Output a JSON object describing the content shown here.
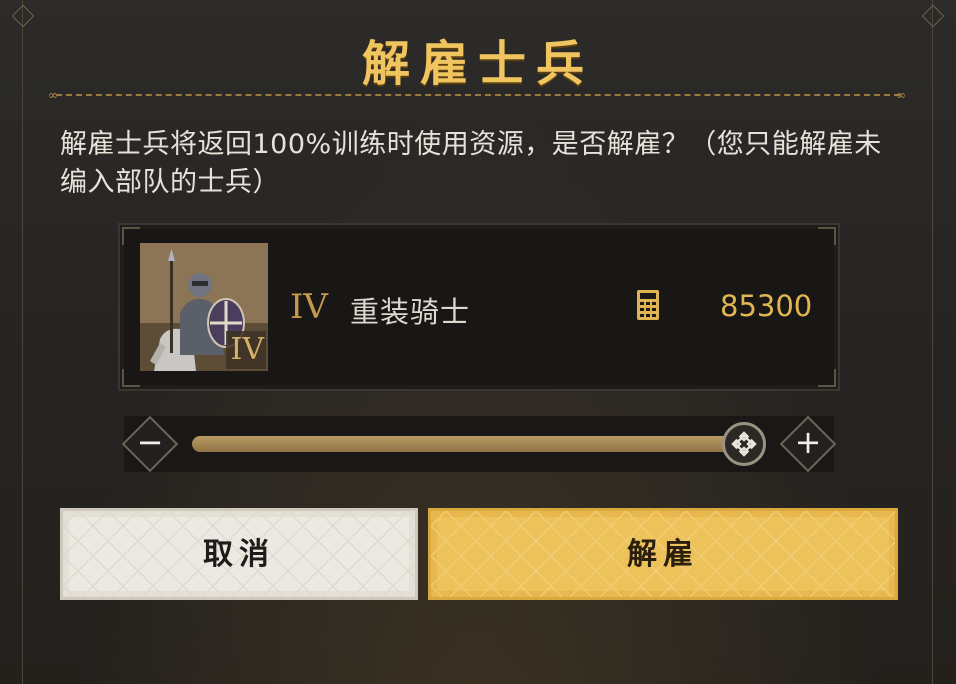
{
  "dialog": {
    "title": "解雇士兵",
    "message": "解雇士兵将返回100%训练时使用资源，是否解雇？（您只能解雇未编入部队的士兵）"
  },
  "unit": {
    "tier": "IV",
    "portrait_tier_badge": "IV",
    "name": "重装骑士",
    "count_icon": "barracks-calculator-icon",
    "count": "85300"
  },
  "slider": {
    "value_fraction": 1.0,
    "minus_label": "−",
    "plus_label": "+"
  },
  "buttons": {
    "cancel": "取消",
    "confirm": "解雇"
  },
  "colors": {
    "accent_gold": "#eec25a",
    "title_gold": "#f0c560",
    "count_gold": "#e1b650",
    "background": "#262422"
  }
}
